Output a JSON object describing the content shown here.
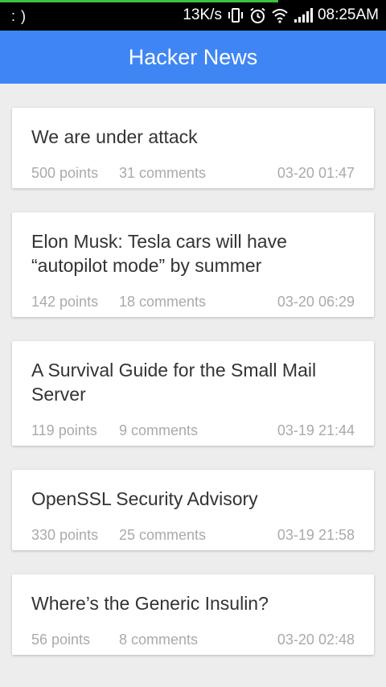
{
  "status_bar": {
    "left_text": ": )",
    "network_speed": "13K/s",
    "time": "08:25AM",
    "icons": [
      "vibrate-icon",
      "alarm-icon",
      "wifi-icon",
      "signal-icon"
    ],
    "progress_fraction": 0.72,
    "progress_color": "#3ec23e"
  },
  "app_bar": {
    "title": "Hacker News",
    "color": "#3f86f4"
  },
  "stories": [
    {
      "title": "We are under attack",
      "points": "500 points",
      "comments": "31 comments",
      "time": "03-20 01:47"
    },
    {
      "title": "Elon Musk: Tesla cars will have “autopilot mode” by summer",
      "points": "142 points",
      "comments": "18 comments",
      "time": "03-20 06:29"
    },
    {
      "title": "A Survival Guide for the Small Mail Server",
      "points": "119 points",
      "comments": "9 comments",
      "time": "03-19 21:44"
    },
    {
      "title": "OpenSSL Security Advisory",
      "points": "330 points",
      "comments": "25 comments",
      "time": "03-19 21:58"
    },
    {
      "title": "Where’s the Generic Insulin?",
      "points": "56 points",
      "comments": "8 comments",
      "time": "03-20 02:48"
    }
  ]
}
